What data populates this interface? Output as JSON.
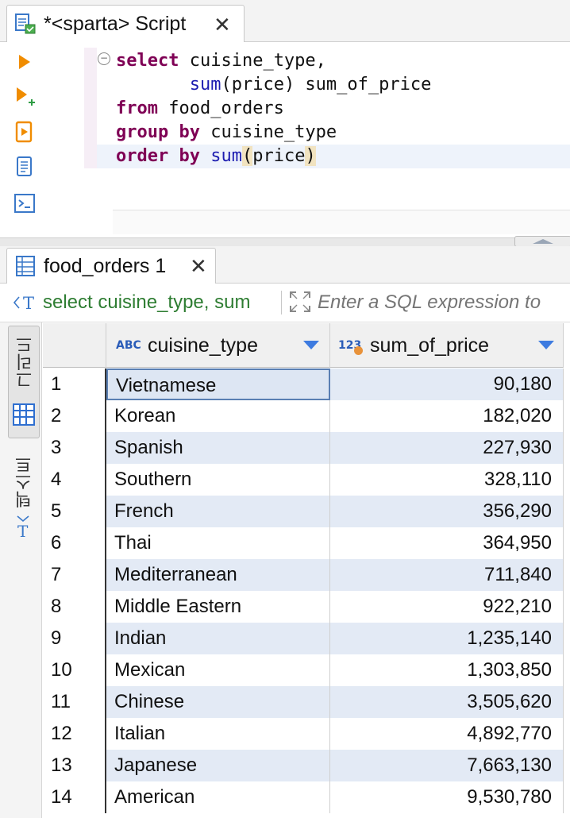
{
  "script_tab": {
    "title": "*<sparta> Script",
    "close": "✕"
  },
  "editor": {
    "lines": [
      {
        "parts": [
          {
            "t": "select",
            "c": "kw"
          },
          {
            "t": " cuisine_type,",
            "c": ""
          }
        ]
      },
      {
        "parts": [
          {
            "t": "       ",
            "c": ""
          },
          {
            "t": "sum",
            "c": "fn"
          },
          {
            "t": "(price) sum_of_price",
            "c": ""
          }
        ]
      },
      {
        "parts": [
          {
            "t": "from",
            "c": "kw"
          },
          {
            "t": " food_orders",
            "c": ""
          }
        ]
      },
      {
        "parts": [
          {
            "t": "group by",
            "c": "kw"
          },
          {
            "t": " cuisine_type",
            "c": ""
          }
        ]
      },
      {
        "parts": [
          {
            "t": "order by",
            "c": "kw"
          },
          {
            "t": " ",
            "c": ""
          },
          {
            "t": "sum",
            "c": "fn"
          },
          {
            "t": "(",
            "c": "paren-hl"
          },
          {
            "t": "price",
            "c": ""
          },
          {
            "t": ")",
            "c": "paren-hl"
          }
        ]
      }
    ],
    "fold": "−"
  },
  "results_tab": {
    "title": "food_orders 1",
    "close": "✕"
  },
  "filter": {
    "query": "select cuisine_type, sum",
    "placeholder": "Enter a SQL expression to"
  },
  "side_panel": {
    "grid_label": "그리드",
    "text_label": "텍스트"
  },
  "grid": {
    "columns": [
      {
        "type_badge": "ABC",
        "name": "cuisine_type"
      },
      {
        "type_badge": "123",
        "name": "sum_of_price"
      }
    ],
    "rows": [
      {
        "n": "1",
        "name": "Vietnamese",
        "price": "90,180"
      },
      {
        "n": "2",
        "name": "Korean",
        "price": "182,020"
      },
      {
        "n": "3",
        "name": "Spanish",
        "price": "227,930"
      },
      {
        "n": "4",
        "name": "Southern",
        "price": "328,110"
      },
      {
        "n": "5",
        "name": "French",
        "price": "356,290"
      },
      {
        "n": "6",
        "name": "Thai",
        "price": "364,950"
      },
      {
        "n": "7",
        "name": "Mediterranean",
        "price": "711,840"
      },
      {
        "n": "8",
        "name": "Middle Eastern",
        "price": "922,210"
      },
      {
        "n": "9",
        "name": "Indian",
        "price": "1,235,140"
      },
      {
        "n": "10",
        "name": "Mexican",
        "price": "1,303,850"
      },
      {
        "n": "11",
        "name": "Chinese",
        "price": "3,505,620"
      },
      {
        "n": "12",
        "name": "Italian",
        "price": "4,892,770"
      },
      {
        "n": "13",
        "name": "Japanese",
        "price": "7,663,130"
      },
      {
        "n": "14",
        "name": "American",
        "price": "9,530,780"
      }
    ]
  },
  "colors": {
    "keyword": "#7f0055",
    "function": "#1c1cb0",
    "filter_query": "#2e7d32",
    "alt_row": "#e3eaf5",
    "accent": "#3d7be0"
  }
}
